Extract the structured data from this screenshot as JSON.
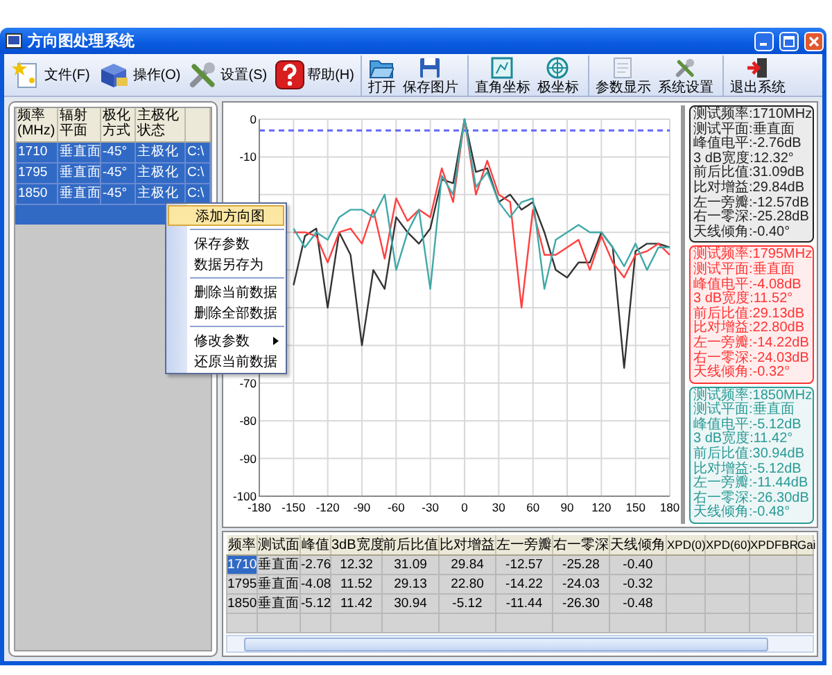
{
  "window": {
    "title": "方向图处理系统"
  },
  "toolbar": {
    "menus": [
      {
        "label": "文件(F)"
      },
      {
        "label": "操作(O)"
      },
      {
        "label": "设置(S)"
      },
      {
        "label": "帮助(H)"
      }
    ],
    "button_groups": [
      [
        {
          "label": "打开"
        },
        {
          "label": "保存图片"
        }
      ],
      [
        {
          "label": "直角坐标"
        },
        {
          "label": "极坐标"
        }
      ],
      [
        {
          "label": "参数显示"
        },
        {
          "label": "系统设置"
        }
      ],
      [
        {
          "label": "退出系统"
        }
      ]
    ]
  },
  "file_list": {
    "columns": [
      "频率 (MHz)",
      "辐射平面",
      "极化方式",
      "主极化状态",
      ""
    ],
    "rows": [
      {
        "selected": true,
        "cells": [
          "1710",
          "垂直面",
          "-45°",
          "主极化",
          "C:\\"
        ]
      },
      {
        "selected": true,
        "cells": [
          "1795",
          "垂直面",
          "-45°",
          "主极化",
          "C:\\"
        ]
      },
      {
        "selected": true,
        "cells": [
          "1850",
          "垂直面",
          "-45°",
          "主极化",
          "C:\\"
        ]
      }
    ]
  },
  "context_menu": {
    "items": [
      {
        "kind": "item",
        "label": "添加方向图",
        "selected": true,
        "submenu": false
      },
      {
        "kind": "separator"
      },
      {
        "kind": "item",
        "label": "保存参数",
        "selected": false,
        "submenu": false
      },
      {
        "kind": "item",
        "label": "数据另存为",
        "selected": false,
        "submenu": false
      },
      {
        "kind": "separator"
      },
      {
        "kind": "item",
        "label": "删除当前数据",
        "selected": false,
        "submenu": false
      },
      {
        "kind": "item",
        "label": "删除全部数据",
        "selected": false,
        "submenu": false
      },
      {
        "kind": "separator"
      },
      {
        "kind": "item",
        "label": "修改参数",
        "selected": false,
        "submenu": true
      },
      {
        "kind": "item",
        "label": "还原当前数据",
        "selected": false,
        "submenu": false
      }
    ]
  },
  "plot": {
    "chart_data": {
      "type": "line",
      "x": [
        -150,
        -140,
        -130,
        -120,
        -110,
        -100,
        -90,
        -80,
        -70,
        -60,
        -50,
        -40,
        -30,
        -20,
        -10,
        0,
        10,
        20,
        30,
        40,
        50,
        60,
        70,
        80,
        90,
        100,
        110,
        120,
        130,
        140,
        150,
        160,
        170,
        180
      ],
      "series": [
        {
          "color": "#333333",
          "values": [
            -44,
            -31,
            -29,
            -50,
            -30,
            -36,
            -60,
            -40,
            -45,
            -26,
            -30,
            -33,
            -29,
            -16,
            -17,
            0,
            -14,
            -13,
            -22,
            -20,
            -24,
            -22,
            -30,
            -40,
            -42,
            -38,
            -38,
            -30,
            -34,
            -66,
            -35,
            -33,
            -33,
            -34
          ]
        },
        {
          "color": "#ff4040",
          "values": [
            -30,
            -30,
            -31,
            -38,
            -30,
            -29,
            -33,
            -24,
            -37,
            -21,
            -27,
            -24,
            -26,
            -13,
            -22,
            0,
            -20,
            -11,
            -20,
            -22,
            -50,
            -24,
            -36,
            -36,
            -34,
            -32,
            -40,
            -31,
            -38,
            -42,
            -36,
            -35,
            -33,
            -36
          ]
        },
        {
          "color": "#40a8a8",
          "values": [
            -29,
            -34,
            -30,
            -32,
            -26,
            -24,
            -24,
            -26,
            -20,
            -40,
            -30,
            -24,
            -45,
            -15,
            -20,
            0,
            -18,
            -14,
            -22,
            -26,
            -22,
            -21,
            -45,
            -32,
            -30,
            -28,
            -30,
            -30,
            -34,
            -39,
            -33,
            -40,
            -34,
            -34
          ]
        }
      ],
      "xlim": [
        -180,
        180
      ],
      "ylim": [
        -100,
        0
      ],
      "xticks": [
        -180,
        -150,
        -120,
        -90,
        -60,
        -30,
        0,
        30,
        60,
        90,
        120,
        150,
        180
      ],
      "yticks": [
        0,
        -10,
        -70,
        -80,
        -90,
        -100
      ],
      "grid": true,
      "ref_lines": [
        {
          "value": -3,
          "axis": "y",
          "color": "#6666ff"
        }
      ]
    },
    "legend": [
      {
        "color": "#222222",
        "lines": [
          "测试频率:1710MHz",
          "测试平面:垂直面",
          "峰值电平:-2.76dB",
          "3 dB宽度:12.32°",
          "前后比值:31.09dB",
          "比对增益:29.84dB",
          "左一旁瓣:-12.57dB",
          "右一零深:-25.28dB",
          "天线倾角:-0.40°"
        ]
      },
      {
        "color": "#ff3333",
        "lines": [
          "测试频率:1795MHz",
          "测试平面:垂直面",
          "峰值电平:-4.08dB",
          "3 dB宽度:11.52°",
          "前后比值:29.13dB",
          "比对增益:22.80dB",
          "左一旁瓣:-14.22dB",
          "右一零深:-24.03dB",
          "天线倾角:-0.32°"
        ]
      },
      {
        "color": "#2a9a96",
        "lines": [
          "测试频率:1850MHz",
          "测试平面:垂直面",
          "峰值电平:-5.12dB",
          "3 dB宽度:11.42°",
          "前后比值:30.94dB",
          "比对增益:-5.12dB",
          "左一旁瓣:-11.44dB",
          "右一零深:-26.30dB",
          "天线倾角:-0.48°"
        ]
      }
    ]
  },
  "results_table": {
    "columns": [
      "频率",
      "测试面",
      "峰值",
      "3dB宽度",
      "前后比值",
      "比对增益",
      "左一旁瓣",
      "右一零深",
      "天线倾角",
      "XPD(0)",
      "XPD(60)",
      "XPDFBR",
      "Gai"
    ],
    "rows": [
      {
        "selected": true,
        "cells": [
          "1710",
          "垂直面",
          "-2.76",
          "12.32",
          "31.09",
          "29.84",
          "-12.57",
          "-25.28",
          "-0.40"
        ]
      },
      {
        "selected": false,
        "cells": [
          "1795",
          "垂直面",
          "-4.08",
          "11.52",
          "29.13",
          "22.80",
          "-14.22",
          "-24.03",
          "-0.32"
        ]
      },
      {
        "selected": false,
        "cells": [
          "1850",
          "垂直面",
          "-5.12",
          "11.42",
          "30.94",
          "-5.12",
          "-11.44",
          "-26.30",
          "-0.48"
        ]
      }
    ]
  }
}
